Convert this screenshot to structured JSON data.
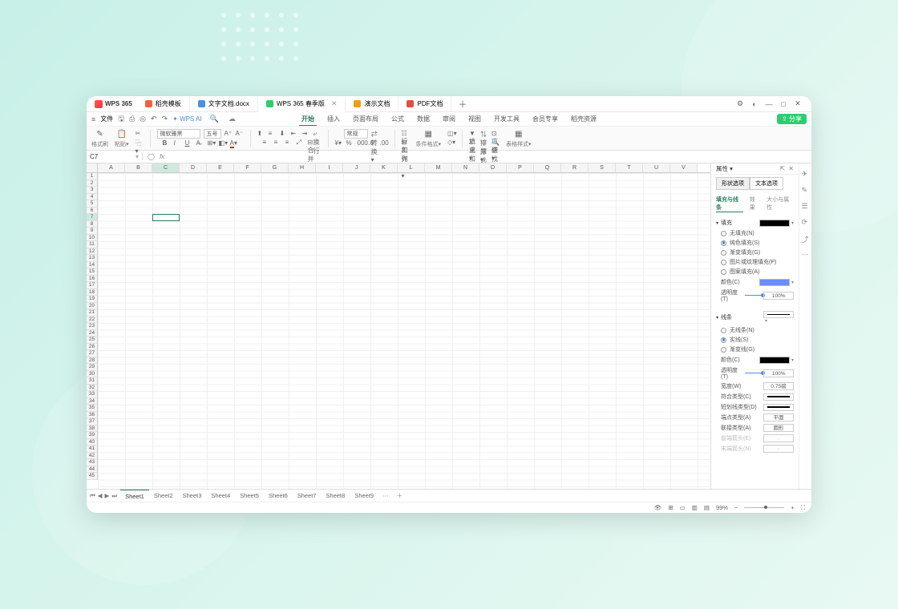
{
  "app": {
    "name": "WPS 365"
  },
  "docTabs": [
    {
      "label": "稻壳模板",
      "iconClass": "ti-red",
      "active": false
    },
    {
      "label": "文字文档.docx",
      "iconClass": "ti-blue",
      "active": false
    },
    {
      "label": "WPS 365 春季版",
      "iconClass": "ti-green",
      "active": true,
      "closable": true
    },
    {
      "label": "演示文档",
      "iconClass": "ti-orange",
      "active": false
    },
    {
      "label": "PDF文档",
      "iconClass": "ti-pdf",
      "active": false
    }
  ],
  "quick": {
    "fileMenu": "文件"
  },
  "ribbonTabs": [
    "开始",
    "插入",
    "页面布局",
    "公式",
    "数据",
    "审阅",
    "视图",
    "开发工具",
    "会员专享",
    "稻壳资源"
  ],
  "ribbonActive": 0,
  "ai": {
    "label": "WPS AI"
  },
  "share": {
    "label": "分享"
  },
  "ribbon": {
    "format_painter": "格式刷",
    "paste": "粘贴",
    "font_name": "微软雅黑",
    "font_size": "五号",
    "wrap": "换行",
    "merge": "合并",
    "number_format": "常规",
    "convert": "转换",
    "row_col": "行和列",
    "worksheet": "工作表",
    "cond_format": "条件格式",
    "fill": "填充",
    "sum": "求和",
    "sort": "排序",
    "filter": "筛选",
    "freeze": "冻结",
    "find": "查找",
    "table_style": "表格样式"
  },
  "cellRef": {
    "value": "C7",
    "fx": "fx"
  },
  "columns": [
    "A",
    "B",
    "C",
    "D",
    "E",
    "F",
    "G",
    "H",
    "I",
    "J",
    "K",
    "L",
    "M",
    "N",
    "O",
    "P",
    "Q",
    "R",
    "S",
    "T",
    "U",
    "V"
  ],
  "rows_count": 45,
  "selection": {
    "col": 2,
    "row": 6
  },
  "sidePanel": {
    "title": "属性",
    "mainTabs": [
      "形状选项",
      "文本选项"
    ],
    "mainActive": 0,
    "subTabs": [
      "填充与线条",
      "效果",
      "大小与属性"
    ],
    "subActive": 0,
    "fill": {
      "title": "填充",
      "options": [
        "无填充(N)",
        "纯色填充(S)",
        "渐变填充(G)",
        "图片或纹理填充(P)",
        "图案填充(A)"
      ],
      "selected": 1,
      "color_label": "颜色(C)",
      "opacity_label": "透明度(T)",
      "opacity_value": "100%"
    },
    "line": {
      "title": "线条",
      "options": [
        "无线条(N)",
        "实线(S)",
        "渐变线(G)"
      ],
      "selected": 1,
      "color_label": "颜色(C)",
      "opacity_label": "透明度(T)",
      "opacity_value": "100%",
      "width_label": "宽度(W)",
      "width_value": "0.75磅",
      "compound_label": "符合类型(C)",
      "dash_label": "短划线类型(D)",
      "cap_label": "端点类型(A)",
      "cap_value": "平面",
      "join_label": "联接类型(A)",
      "join_value": "圆形",
      "arrow_begin_label": "前端箭头(E)",
      "arrow_end_label": "末端箭头(N)"
    }
  },
  "sheets": [
    "Sheet1",
    "Sheet2",
    "Sheet3",
    "Sheet4",
    "Sheet5",
    "Sheet6",
    "Sheet7",
    "Sheet8",
    "Sheet9"
  ],
  "sheetActive": 0,
  "status": {
    "zoom": "99%"
  }
}
